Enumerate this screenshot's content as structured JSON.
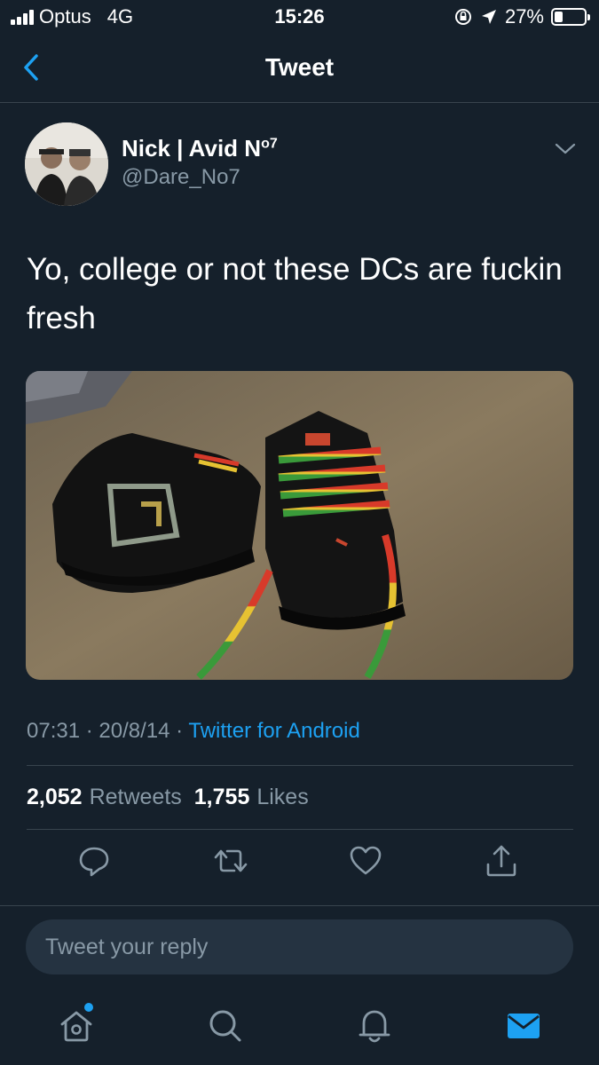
{
  "status_bar": {
    "carrier": "Optus",
    "network": "4G",
    "time": "15:26",
    "battery": "27%",
    "battery_level": 0.27
  },
  "header": {
    "title": "Tweet",
    "back_icon": "chevron-left-icon"
  },
  "tweet": {
    "display_name": "Nick | Avid N",
    "display_name_sup": "o7",
    "handle": "@Dare_No7",
    "text": "Yo, college or not these DCs are fuckin fresh",
    "time": "07:31",
    "date": "20/8/14",
    "source": "Twitter for Android",
    "separator": "·",
    "retweets_count": "2,052",
    "retweets_label": "Retweets",
    "likes_count": "1,755",
    "likes_label": "Likes"
  },
  "actions": [
    "reply-icon",
    "retweet-icon",
    "like-icon",
    "share-icon"
  ],
  "reply": {
    "placeholder": "Tweet your reply"
  },
  "tabbar": [
    "home-icon",
    "search-icon",
    "notifications-icon",
    "messages-icon"
  ],
  "colors": {
    "background": "#15202b",
    "accent": "#1da1f2",
    "muted": "#8899a6",
    "divider": "#38444d"
  }
}
